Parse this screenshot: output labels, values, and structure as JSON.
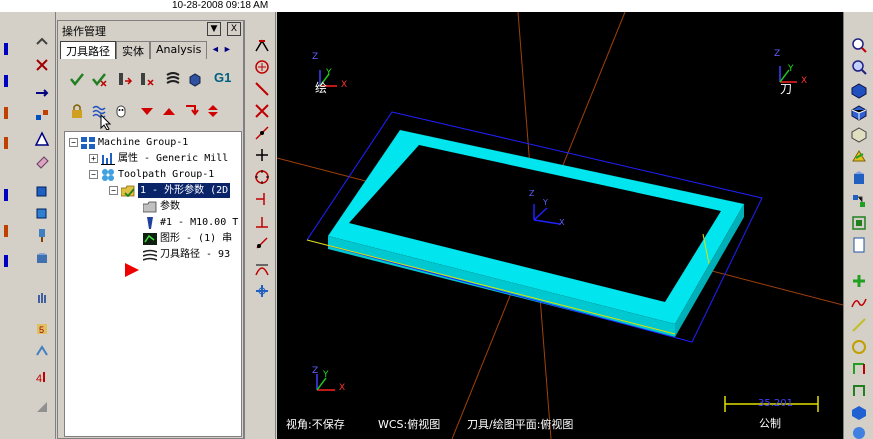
{
  "window": {
    "datetime": "10-28-2008 09:18 AM"
  },
  "ops_manager": {
    "title": "操作管理",
    "dropdown_btn": "▼",
    "close_btn": "X",
    "tabs": [
      {
        "label": "刀具路径",
        "active": true
      },
      {
        "label": "实体",
        "active": false
      },
      {
        "label": "Analysis",
        "active": false
      }
    ],
    "tab_prev": "◄",
    "tab_next": "►",
    "g1_label": "G1",
    "tree": {
      "machine_group": "Machine Group-1",
      "properties": "属性 - Generic Mill",
      "toolpath_group": "Toolpath Group-1",
      "operation": "1 - 外形参数 (2D",
      "params": "参数",
      "tool": "#1 - M10.00 T",
      "geometry": "图形 - (1) 串",
      "toolpath": "刀具路径 - 93"
    }
  },
  "viewport": {
    "wcs_tl_x": "X",
    "wcs_tl_y": "Y",
    "wcs_tl_z": "Z",
    "wcs_tl_label": "绘",
    "wcs_tr_x": "X",
    "wcs_tr_y": "Y",
    "wcs_tr_z": "Z",
    "wcs_tr_label": "刀",
    "wcs_bl_x": "X",
    "wcs_bl_y": "Y",
    "wcs_bl_z": "Z",
    "origin_x": "X",
    "origin_y": "Y",
    "origin_z": "Z",
    "status_view": "视角:不保存",
    "status_wcs": "WCS:俯视图",
    "status_plane": "刀具/绘图平面:俯视图",
    "scale_value": "35.201",
    "scale_unit": "公制",
    "colors": {
      "part": "#00e5ee",
      "axis_orange": "#a0400a",
      "axis_blue": "#2020ff",
      "background": "#000000"
    }
  }
}
